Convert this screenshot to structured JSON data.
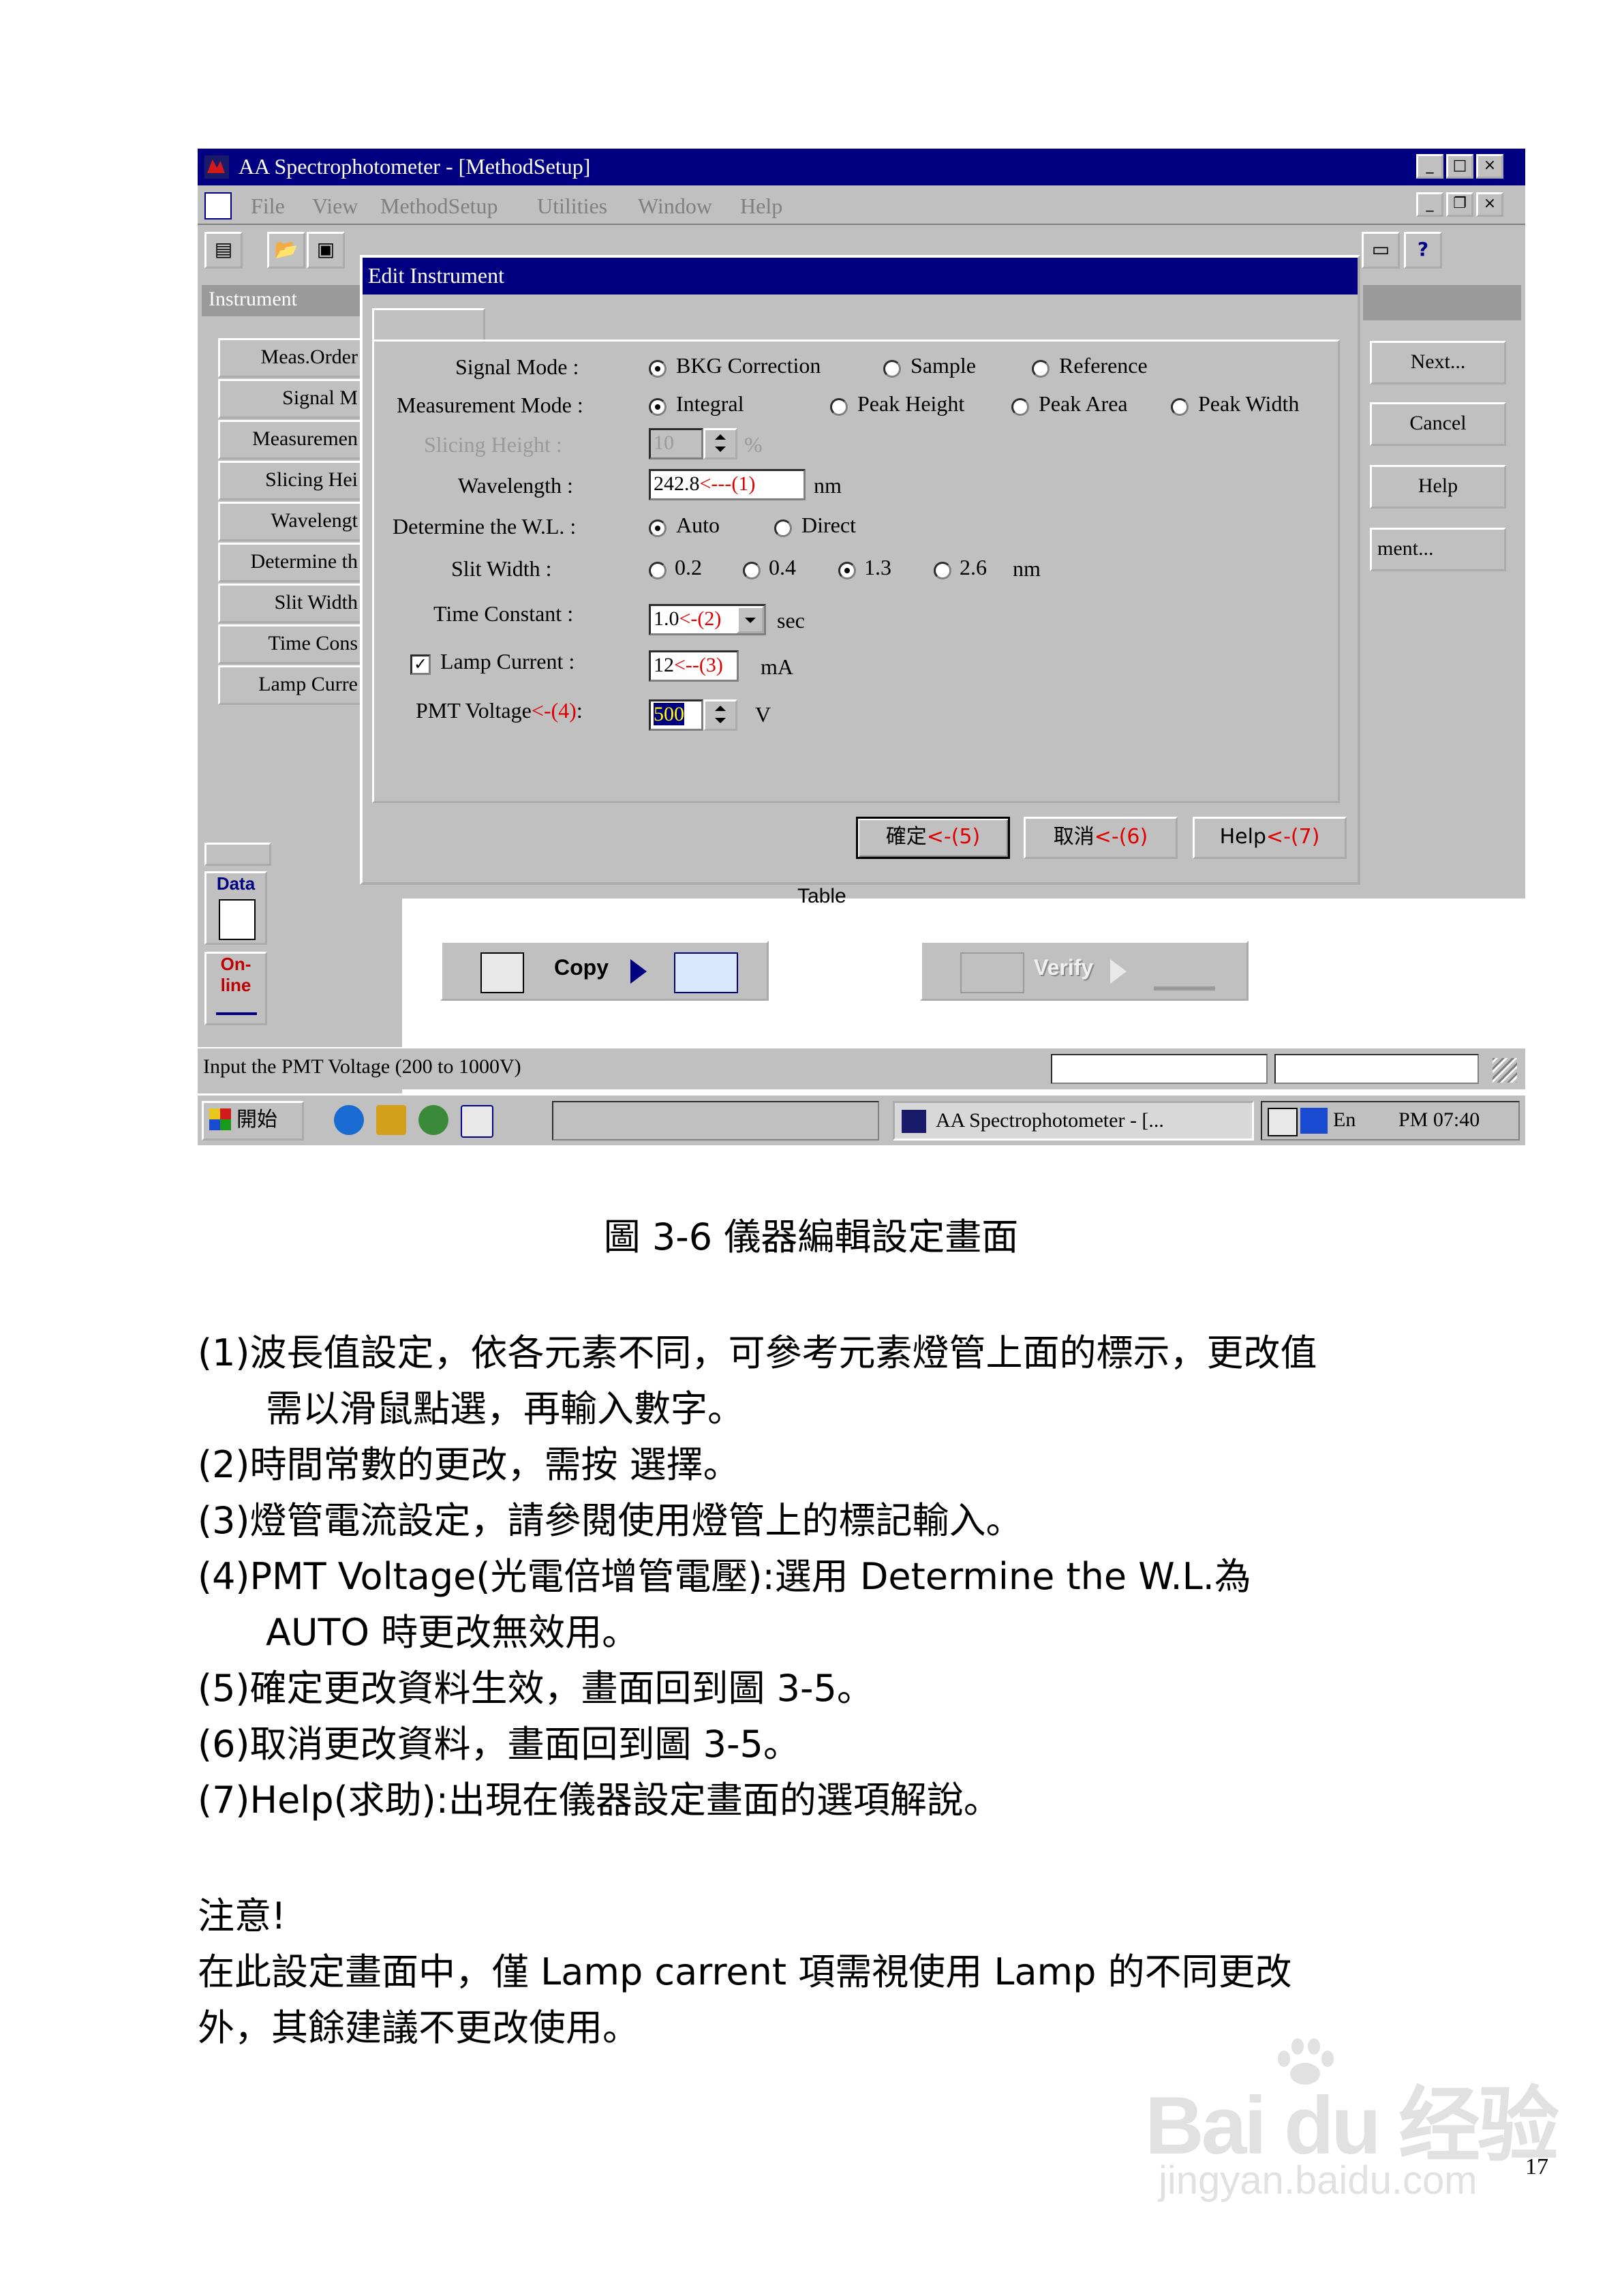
{
  "window": {
    "title": "AA Spectrophotometer - [MethodSetup]",
    "menu": [
      "File",
      "View",
      "MethodSetup",
      "Utilities",
      "Window",
      "Help"
    ],
    "panel_header": "Instrument",
    "instrument_items": [
      "Meas.Order",
      "Signal M",
      "Measuremen",
      "Slicing Hei",
      "Wavelengt",
      "Determine th",
      "Slit Width",
      "Time Cons",
      "Lamp Curre"
    ],
    "right_buttons": [
      "Next...",
      "Cancel",
      "Help",
      "ment..."
    ],
    "table_label": "Table",
    "copy_button": "Copy",
    "verify_button": "Verify",
    "side_icons": [
      "Data",
      "On-line"
    ],
    "status_text": "Input the PMT Voltage (200 to 1000V)",
    "taskbar": {
      "start": "開始",
      "task": "AA Spectrophotometer - [...",
      "lang": "En",
      "clock": "PM 07:40"
    }
  },
  "dialog": {
    "title": "Edit Instrument",
    "signal_mode": {
      "label": "Signal Mode  :",
      "options": [
        "BKG Correction",
        "Sample",
        "Reference"
      ],
      "selected": 0
    },
    "measurement_mode": {
      "label": "Measurement Mode :",
      "options": [
        "Integral",
        "Peak Height",
        "Peak Area",
        "Peak Width"
      ],
      "selected": 0
    },
    "slicing_height": {
      "label": "Slicing Height  :",
      "value": "10",
      "unit": "%"
    },
    "wavelength": {
      "label": "Wavelength  :",
      "value": "242.8",
      "note": "<---(1)",
      "unit": "nm"
    },
    "determine_wl": {
      "label": "Determine the W.L. :",
      "options": [
        "Auto",
        "Direct"
      ],
      "selected": 0
    },
    "slit_width": {
      "label": "Slit Width  :",
      "options": [
        "0.2",
        "0.4",
        "1.3",
        "2.6"
      ],
      "selected": 2,
      "unit": "nm"
    },
    "time_constant": {
      "label": "Time Constant  :",
      "value": "1.0",
      "note": "<-(2)",
      "unit": "sec"
    },
    "lamp_current": {
      "label": "Lamp Current  :",
      "value": "12",
      "note": "<--(3)",
      "unit": "mA"
    },
    "pmt_voltage": {
      "label": "PMT Voltage",
      "note": "<-(4)",
      "colon": ":",
      "value": "500",
      "unit": "V"
    },
    "ok_button": {
      "label": "確定",
      "note": "<-(5)"
    },
    "cancel_button": {
      "label": "取消",
      "note": "<-(6)"
    },
    "help_button": {
      "label": "Help",
      "note": "<-(7)"
    }
  },
  "document": {
    "caption": "圖 3-6  儀器編輯設定畫面",
    "lines": [
      "(1)波長值設定，依各元素不同，可參考元素燈管上面的標示，更改值",
      "需以滑鼠點選，再輸入數字。",
      "(2)時間常數的更改，需按     選擇。",
      "(3)燈管電流設定，請參閱使用燈管上的標記輸入。",
      "(4)PMT Voltage(光電倍增管電壓):選用 Determine the W.L.為",
      "AUTO 時更改無效用。",
      "(5)確定更改資料生效，畫面回到圖 3-5。",
      "(6)取消更改資料，畫面回到圖 3-5。",
      "(7)Help(求助):出現在儀器設定畫面的選項解說。",
      "注意!",
      "在此設定畫面中，僅 Lamp carrent 項需視使用 Lamp 的不同更改",
      "外，其餘建議不更改使用。"
    ],
    "page_number": "17"
  },
  "watermark": {
    "brand": "Bai du 经验",
    "url": "jingyan.baidu.com"
  },
  "colors": {
    "titlebar": "#000080",
    "window": "#c0c0c0",
    "annotation": "#e00000"
  }
}
